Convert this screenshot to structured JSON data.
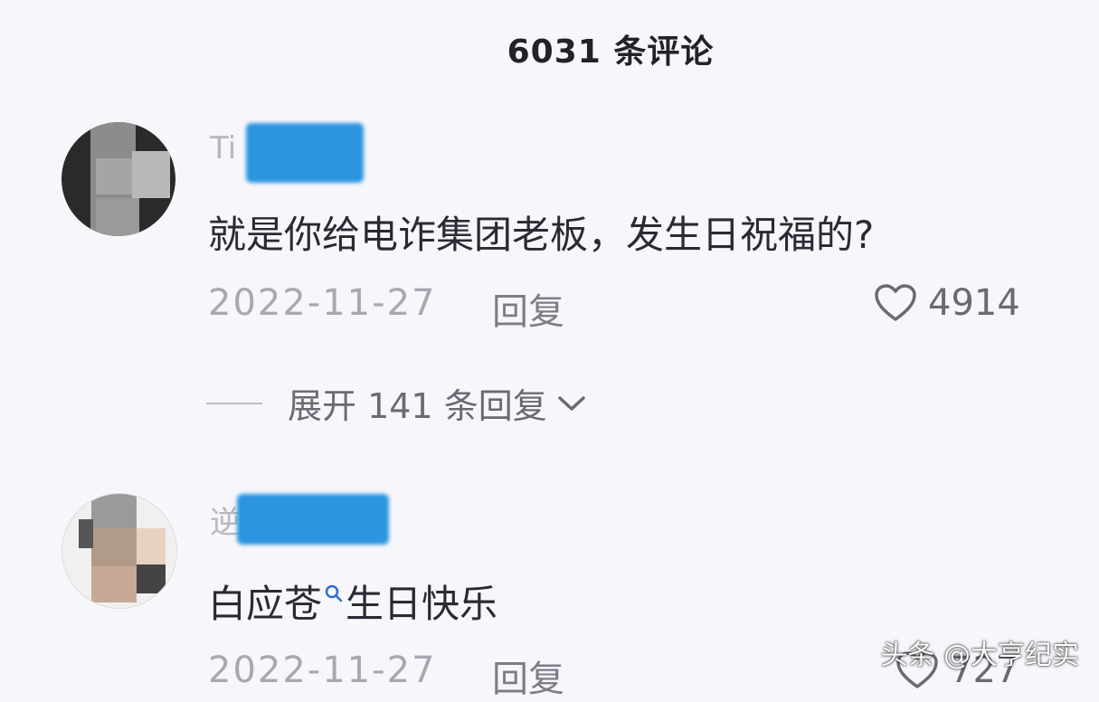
{
  "header": {
    "title": "6031 条评论"
  },
  "comments": [
    {
      "username_visible": "Ti",
      "text": "就是你给电诈集团老板，发生日祝福的?",
      "date": "2022-11-27",
      "reply_label": "回复",
      "likes": "4914",
      "expand_label": "展开 141 条回复"
    },
    {
      "username_visible": "逆",
      "text_part1": "白应苍",
      "text_part2": "生日快乐",
      "date": "2022-11-27",
      "reply_label": "回复",
      "likes": "727"
    }
  ],
  "watermark": "头条 @大亨纪实",
  "colors": {
    "background": "#f6f6fb",
    "username_blur": "#2b95e0",
    "text": "#2a2a35",
    "muted": "#a8a8b3"
  },
  "icons": {
    "like": "heart-icon",
    "expand": "chevron-down-icon",
    "search_hint": "search-hint-icon"
  }
}
